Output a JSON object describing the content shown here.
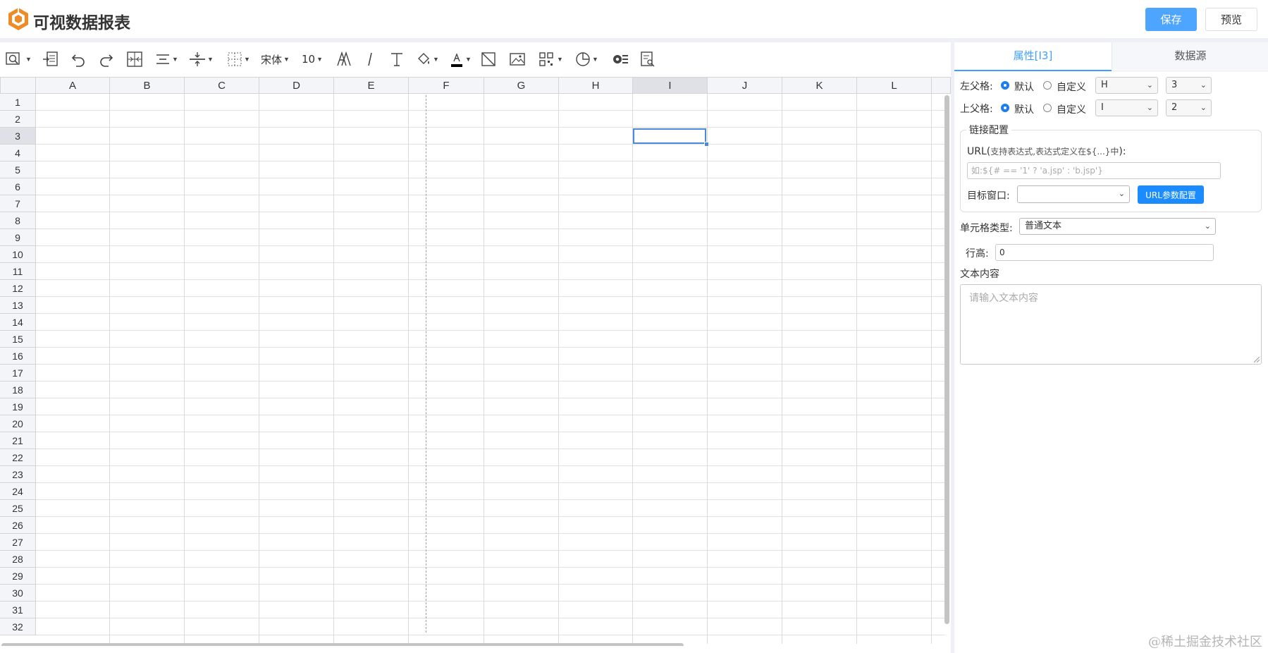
{
  "app": {
    "title": "可视数据报表"
  },
  "header": {
    "save_label": "保存",
    "preview_label": "预览"
  },
  "toolbar": {
    "font_name": "宋体",
    "font_size": "10"
  },
  "sheet": {
    "columns": [
      "A",
      "B",
      "C",
      "D",
      "E",
      "F",
      "G",
      "H",
      "I",
      "J",
      "K",
      "L"
    ],
    "rows": [
      "1",
      "2",
      "3",
      "4",
      "5",
      "6",
      "7",
      "8",
      "9",
      "10",
      "11",
      "12",
      "13",
      "14",
      "15",
      "16",
      "17",
      "18",
      "19",
      "20",
      "21",
      "22",
      "23",
      "24",
      "25",
      "26",
      "27",
      "28",
      "29",
      "30",
      "31",
      "32"
    ],
    "selected_column": "I",
    "selected_row": "3"
  },
  "panel": {
    "tabs": [
      "属性[I3]",
      "数据源"
    ],
    "left_parent": {
      "label": "左父格:",
      "opt_default": "默认",
      "opt_custom": "自定义",
      "col": "H",
      "row": "3"
    },
    "top_parent": {
      "label": "上父格:",
      "opt_default": "默认",
      "opt_custom": "自定义",
      "col": "I",
      "row": "2"
    },
    "link": {
      "legend": "链接配置",
      "url_label": "URL(",
      "url_hint": "支持表达式,表达式定义在${...}中",
      "url_suffix": "):",
      "url_placeholder": "如:${# == '1' ? 'a.jsp' : 'b.jsp'}",
      "target_label": "目标窗口:",
      "target_value": "",
      "param_button": "URL参数配置"
    },
    "cell_type_label": "单元格类型:",
    "cell_type_value": "普通文本",
    "row_height_label": "行高:",
    "row_height_value": "0",
    "text_content_label": "文本内容",
    "text_content_placeholder": "请输入文本内容"
  },
  "watermark": "@稀土掘金技术社区"
}
